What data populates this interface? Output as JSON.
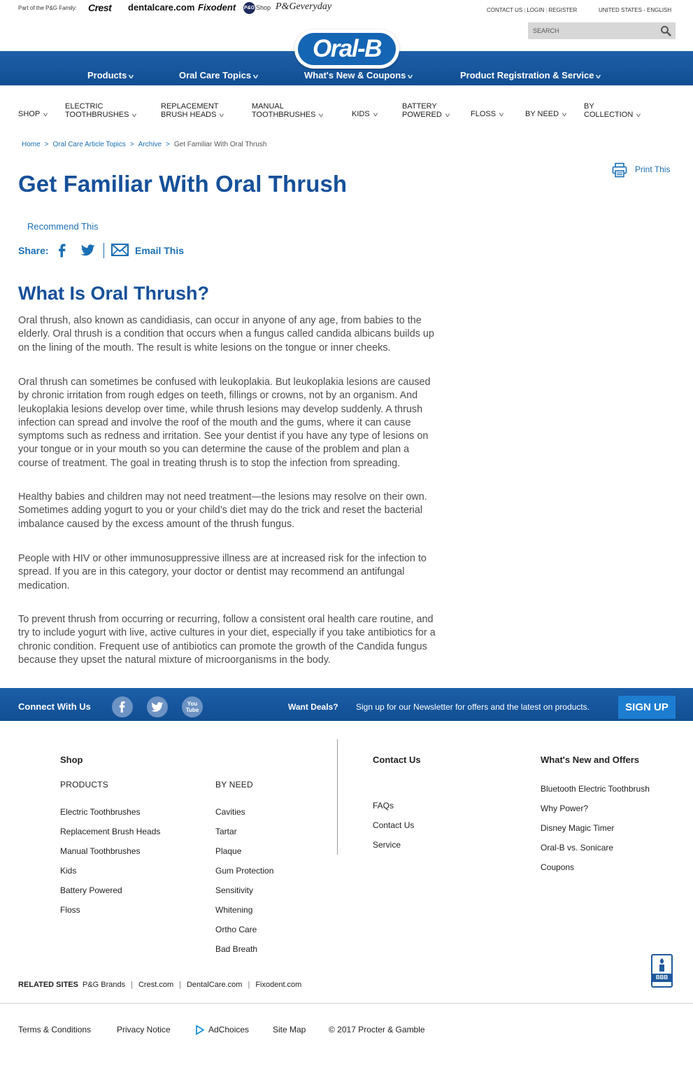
{
  "topbar": {
    "family_label": "Part of the P&G Family:",
    "brands": [
      "Crest",
      "dentalcare.com",
      "Fixodent",
      "P&G",
      "Shop",
      "P&Geveryday"
    ],
    "utility": {
      "contact": "CONTACT US",
      "login": "LOGIN",
      "register": "REGISTER",
      "region": "UNITED STATES - ENGLISH"
    },
    "search_placeholder": "SEARCH"
  },
  "logo_text": "Oral-B",
  "main_nav": [
    "Products",
    "Oral Care Topics",
    "What's New & Coupons",
    "Product Registration & Service"
  ],
  "category_nav": [
    {
      "line1": "SHOP",
      "line2": ""
    },
    {
      "line1": "ELECTRIC",
      "line2": "TOOTHBRUSHES"
    },
    {
      "line1": "REPLACEMENT",
      "line2": "BRUSH HEADS"
    },
    {
      "line1": "MANUAL",
      "line2": "TOOTHBRUSHES"
    },
    {
      "line1": "KIDS",
      "line2": ""
    },
    {
      "line1": "BATTERY",
      "line2": "POWERED"
    },
    {
      "line1": "FLOSS",
      "line2": ""
    },
    {
      "line1": "BY NEED",
      "line2": ""
    },
    {
      "line1": "BY",
      "line2": "COLLECTION"
    }
  ],
  "breadcrumb": {
    "items": [
      "Home",
      "Oral Care Article Topics",
      "Archive"
    ],
    "separator": ">",
    "current": "Get Familiar With Oral Thrush"
  },
  "print_label": "Print This",
  "article": {
    "title": "Get Familiar With Oral Thrush",
    "recommend_label": "Recommend This",
    "share_label": "Share:",
    "email_label": "Email This",
    "section_heading": "What Is Oral Thrush?",
    "paragraphs": [
      [
        "Oral thrush, also known as candidiasis, can occur in anyone of any age, from babies to the",
        "elderly. Oral thrush is a condition that occurs when a fungus called candida albicans builds up",
        "on the lining of the mouth. The result is white lesions on the tongue or inner cheeks."
      ],
      [
        "Oral thrush can sometimes be confused with leukoplakia. But leukoplakia lesions are caused",
        "by chronic irritation from rough edges on teeth, fillings or crowns, not by an organism. And",
        "leukoplakia lesions develop over time, while thrush lesions may develop suddenly. A thrush",
        "infection can spread and involve the roof of the mouth and the gums, where it can cause",
        "symptoms such as redness and irritation. See your dentist if you have any type of lesions on",
        "your tongue or in your mouth so you can determine the cause of the problem and plan a",
        "course of treatment. The goal in treating thrush is to stop the infection from spreading."
      ],
      [
        "Healthy babies and children may not need treatment—the lesions may resolve on their own.",
        "Sometimes adding yogurt to you or your child’s diet may do the trick and reset the bacterial",
        "imbalance caused by the excess amount of the thrush fungus."
      ],
      [
        "People with HIV or other immunosuppressive illness are at increased risk for the infection to",
        "spread. If you are in this category, your doctor or dentist may recommend an antifungal",
        "medication."
      ],
      [
        "To prevent thrush from occurring or recurring, follow a consistent oral health care routine, and",
        "try to include yogurt with live, active cultures in your diet, especially if you take antibiotics for a",
        "chronic condition. Frequent use of antibiotics can promote the growth of the Candida fungus",
        "because they upset the natural mixture of microorganisms in the body."
      ]
    ]
  },
  "connect_bar": {
    "label": "Connect With Us",
    "social": [
      "f",
      "t",
      "You Tube"
    ],
    "want_deals": "Want Deals?",
    "newsletter_text": "Sign up for our Newsletter for offers and the latest on products.",
    "signup_label": "SIGN UP"
  },
  "footer": {
    "shop_heading": "Shop",
    "products_heading": "PRODUCTS",
    "products": [
      "Electric Toothbrushes",
      "Replacement Brush Heads",
      "Manual Toothbrushes",
      "Kids",
      "Battery Powered",
      "Floss"
    ],
    "by_need_heading": "BY NEED",
    "by_need": [
      "Cavities",
      "Tartar",
      "Plaque",
      "Gum Protection",
      "Sensitivity",
      "Whitening",
      "Ortho Care",
      "Bad Breath"
    ],
    "contact_heading": "Contact Us",
    "contact": [
      "FAQs",
      "Contact Us",
      "Service"
    ],
    "offers_heading": "What's New and Offers",
    "offers": [
      "Bluetooth Electric Toothbrush",
      "Why Power?",
      "Disney Magic Timer",
      "Oral-B vs. Sonicare",
      "Coupons"
    ],
    "related_label": "RELATED SITES",
    "related": [
      "P&G Brands",
      "Crest.com",
      "DentalCare.com",
      "Fixodent.com"
    ],
    "bbb_label": "BBB",
    "bottom_links": {
      "terms": "Terms & Conditions",
      "privacy": "Privacy Notice",
      "adchoices": "AdChoices",
      "sitemap": "Site Map",
      "copyright": "© 2017 Procter & Gamble"
    }
  }
}
